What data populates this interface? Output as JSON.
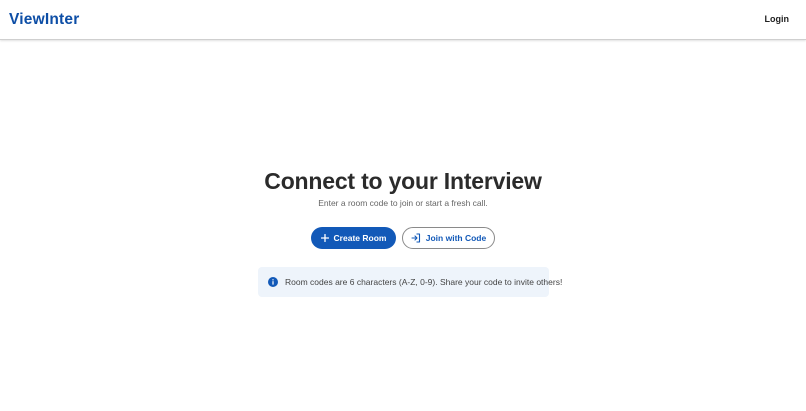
{
  "header": {
    "logo": "ViewInter",
    "login_label": "Login"
  },
  "hero": {
    "title": "Connect to your Interview",
    "subtitle": "Enter a room code to join or start a fresh call."
  },
  "actions": {
    "create_label": "Create Room",
    "create_icon": "plus-icon",
    "join_label": "Join with Code",
    "join_icon": "login-arrow-icon"
  },
  "info": {
    "icon": "info-icon",
    "text": "Room codes are 6 characters (A-Z, 0-9). Share your code to invite others!"
  },
  "colors": {
    "brand": "#0d4ea6",
    "primary_button": "#1259b8",
    "info_background": "#eef4fb"
  }
}
